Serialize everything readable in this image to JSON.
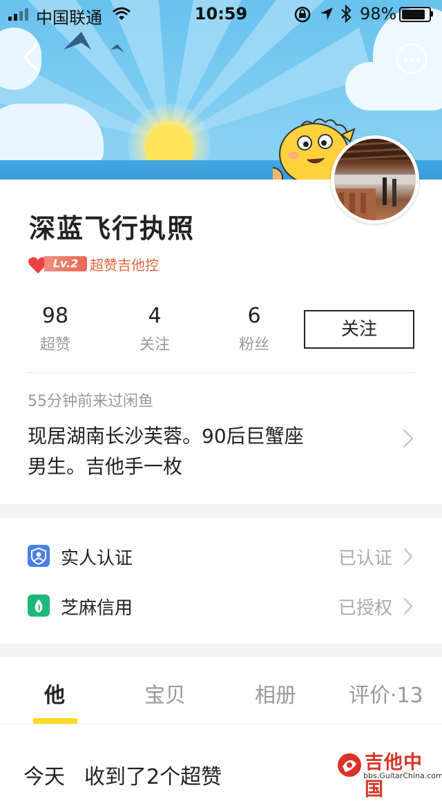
{
  "status_bar": {
    "carrier": "中国联通",
    "time": "10:59",
    "battery_percent": "98%",
    "battery_level": 0.98
  },
  "profile": {
    "nickname": "深蓝飞行执照",
    "level": "Lv.2",
    "level_title": "超赞吉他控",
    "stats": [
      {
        "value": "98",
        "label": "超赞"
      },
      {
        "value": "4",
        "label": "关注"
      },
      {
        "value": "6",
        "label": "粉丝"
      }
    ],
    "follow_label": "关注",
    "last_seen": "55分钟前来过闲鱼",
    "bio_line1": "现居湖南长沙芙蓉。90后巨蟹座",
    "bio_line2": "男生。吉他手一枚"
  },
  "verifications": [
    {
      "label": "实人认证",
      "status": "已认证",
      "icon": "user-verify-icon",
      "color": "#4a80e8"
    },
    {
      "label": "芝麻信用",
      "status": "已授权",
      "icon": "sesame-credit-icon",
      "color": "#1bb879"
    }
  ],
  "tabs": [
    {
      "label": "他",
      "active": true
    },
    {
      "label": "宝贝",
      "active": false
    },
    {
      "label": "相册",
      "active": false
    },
    {
      "label": "评价·13",
      "active": false
    }
  ],
  "feed": {
    "day": "今天",
    "text": "收到了2个超赞"
  },
  "watermark": {
    "text": "吉他中国",
    "url": "bbs.GuitarChina.com"
  },
  "colors": {
    "accent": "#ffda22",
    "level_text": "#e4643b",
    "sky": "#67c2ee"
  }
}
